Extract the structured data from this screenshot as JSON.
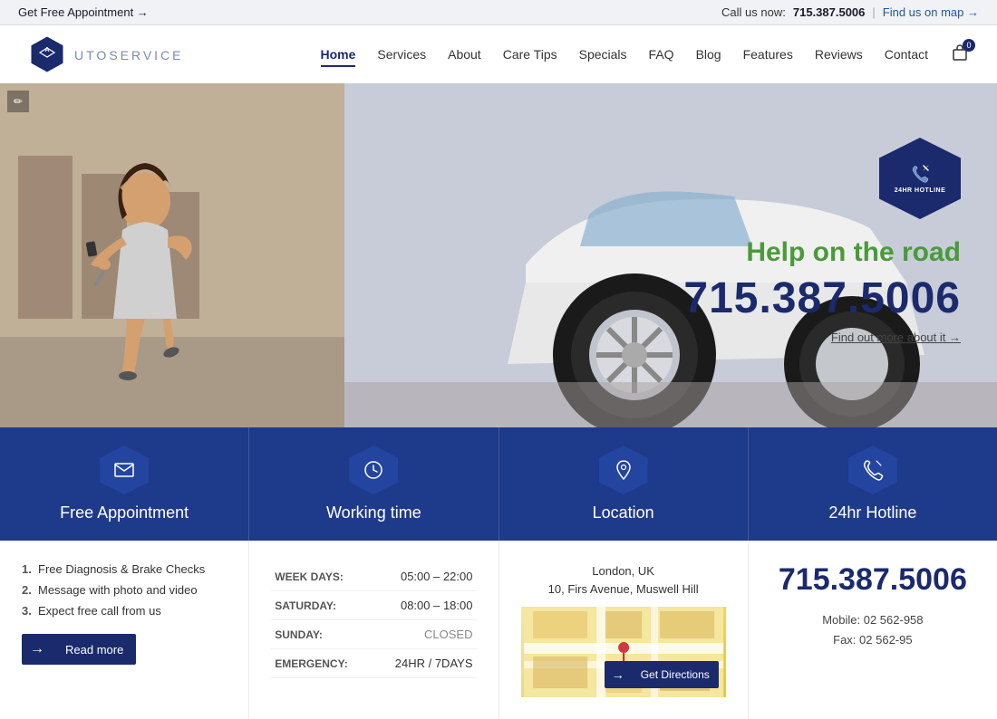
{
  "topbar": {
    "left_label": "Get Free Appointment →",
    "call_label": "Call us now:",
    "phone": "715.387.5006",
    "separator": "|",
    "map_link": "Find us on map →"
  },
  "header": {
    "logo_main": "UTO",
    "logo_dash": "-",
    "logo_sub": "SERVICE",
    "nav": [
      {
        "label": "Home",
        "active": true
      },
      {
        "label": "Services",
        "active": false
      },
      {
        "label": "About",
        "active": false
      },
      {
        "label": "Care Tips",
        "active": false
      },
      {
        "label": "Specials",
        "active": false
      },
      {
        "label": "FAQ",
        "active": false
      },
      {
        "label": "Blog",
        "active": false
      },
      {
        "label": "Features",
        "active": false
      },
      {
        "label": "Reviews",
        "active": false
      },
      {
        "label": "Contact",
        "active": false
      }
    ],
    "cart_count": "0"
  },
  "hero": {
    "hotline_label": "24HR HOTLINE",
    "tagline": "Help on the road",
    "phone": "715.387.5006",
    "findout": "Find out more about it →"
  },
  "info_strip": [
    {
      "label": "Free Appointment",
      "icon": "mail"
    },
    {
      "label": "Working time",
      "icon": "clock"
    },
    {
      "label": "Location",
      "icon": "pin"
    },
    {
      "label": "24hr Hotline",
      "icon": "phone"
    }
  ],
  "free_appointment": {
    "items": [
      {
        "num": "1.",
        "text": "Free Diagnosis & Brake Checks"
      },
      {
        "num": "2.",
        "text": "Message with photo and video"
      },
      {
        "num": "3.",
        "text": "Expect free call from us"
      }
    ],
    "button_label": "Read more"
  },
  "working_time": {
    "rows": [
      {
        "day": "WEEK DAYS:",
        "hours": "05:00 – 22:00",
        "closed": false
      },
      {
        "day": "SATURDAY:",
        "hours": "08:00 – 18:00",
        "closed": false
      },
      {
        "day": "SUNDAY:",
        "hours": "CLOSED",
        "closed": true
      },
      {
        "day": "EMERGENCY:",
        "hours": "24HR / 7DAYS",
        "closed": false
      }
    ]
  },
  "location": {
    "city": "London, UK",
    "address": "10, Firs Avenue, Muswell Hill",
    "button_label": "Get Directions"
  },
  "hotline": {
    "phone": "715.387.5006",
    "mobile_label": "Mobile: 02 562-958",
    "fax_label": "Fax: 02 562-95"
  }
}
